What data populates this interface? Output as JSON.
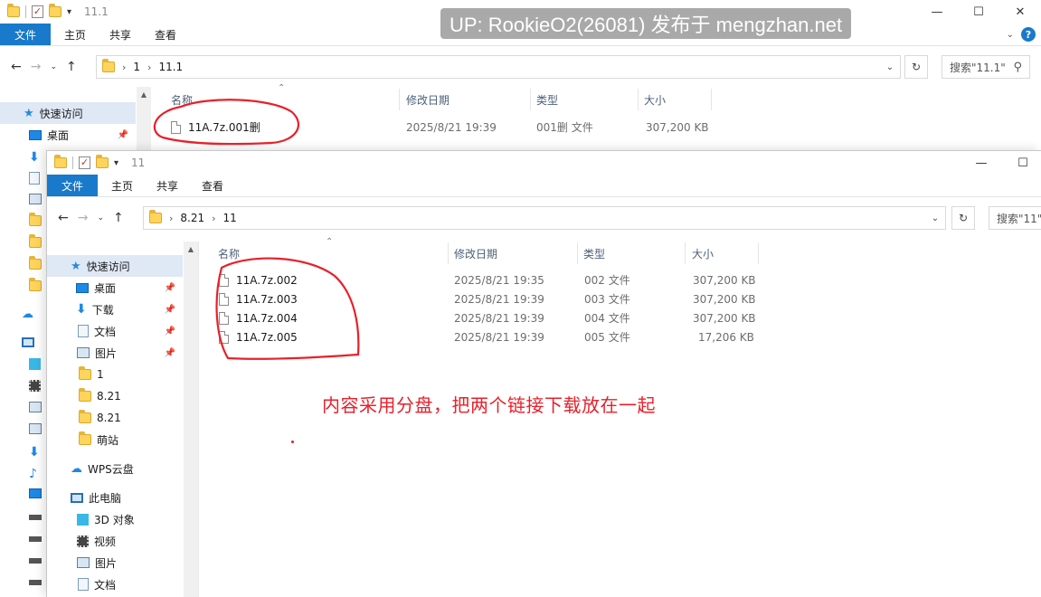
{
  "watermark": "UP: RookieO2(26081) 发布于 mengzhan.net",
  "back_window": {
    "title": "11.1",
    "ribbon": {
      "file": "文件",
      "home": "主页",
      "share": "共享",
      "view": "查看"
    },
    "address": {
      "seg1": "1",
      "seg2": "11.1"
    },
    "search_placeholder": "搜索\"11.1\"",
    "columns": {
      "name": "名称",
      "modified": "修改日期",
      "type": "类型",
      "size": "大小"
    },
    "sidebar": {
      "quick_access": "快速访问",
      "desktop": "桌面"
    },
    "files": [
      {
        "name": "11A.7z.001删",
        "modified": "2025/8/21 19:39",
        "type": "001删 文件",
        "size": "307,200 KB"
      }
    ]
  },
  "front_window": {
    "title": "11",
    "ribbon": {
      "file": "文件",
      "home": "主页",
      "share": "共享",
      "view": "查看"
    },
    "address": {
      "seg1": "8.21",
      "seg2": "11"
    },
    "search_placeholder": "搜索\"11\"",
    "columns": {
      "name": "名称",
      "modified": "修改日期",
      "type": "类型",
      "size": "大小"
    },
    "sidebar": {
      "quick_access": "快速访问",
      "desktop": "桌面",
      "downloads": "下载",
      "documents": "文档",
      "pictures": "图片",
      "folder_1": "1",
      "folder_821a": "8.21",
      "folder_821b": "8.21",
      "folder_mengzhan": "萌站",
      "wps_cloud": "WPS云盘",
      "this_pc": "此电脑",
      "objects_3d": "3D 对象",
      "videos": "视频",
      "pictures2": "图片",
      "documents2": "文档"
    },
    "files": [
      {
        "name": "11A.7z.002",
        "modified": "2025/8/21 19:35",
        "type": "002 文件",
        "size": "307,200 KB"
      },
      {
        "name": "11A.7z.003",
        "modified": "2025/8/21 19:39",
        "type": "003 文件",
        "size": "307,200 KB"
      },
      {
        "name": "11A.7z.004",
        "modified": "2025/8/21 19:39",
        "type": "004 文件",
        "size": "307,200 KB"
      },
      {
        "name": "11A.7z.005",
        "modified": "2025/8/21 19:39",
        "type": "005 文件",
        "size": "17,206 KB"
      }
    ]
  },
  "annotation": "内容采用分盘，把两个链接下载放在一起",
  "colors": {
    "accent": "#1979ca",
    "ink": "#e8202a"
  }
}
